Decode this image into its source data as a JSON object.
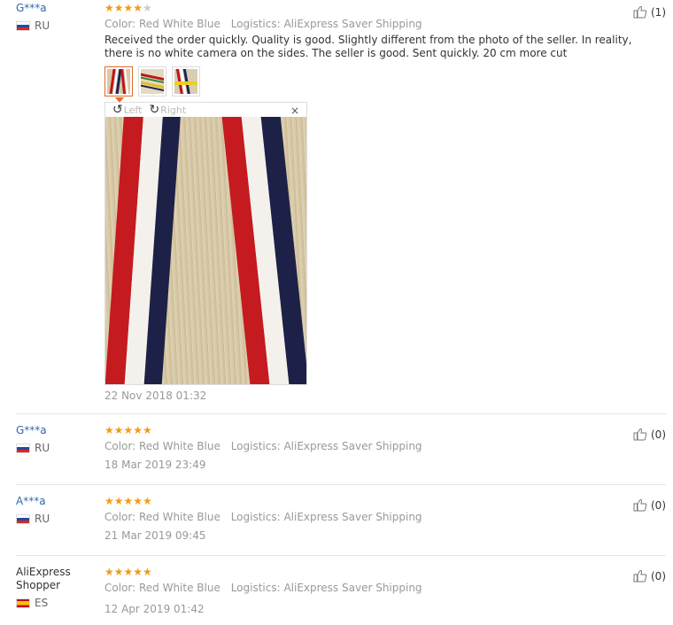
{
  "reviews": [
    {
      "user": "G***a",
      "country": "RU",
      "rating": 4,
      "color": "Color: Red White Blue",
      "logistics": "Logistics: AliExpress Saver Shipping",
      "text": "Received the order quickly. Quality is good. Slightly different from the photo of the seller. In reality, there is no white camera on the sides. The seller is good. Sent quickly. 20 cm more cut",
      "likes": "(1)",
      "date": "22 Nov 2018 01:32"
    },
    {
      "user": "G***a",
      "country": "RU",
      "rating": 5,
      "color": "Color: Red White Blue",
      "logistics": "Logistics: AliExpress Saver Shipping",
      "likes": "(0)",
      "date": "18 Mar 2019 23:49"
    },
    {
      "user": "A***a",
      "country": "RU",
      "rating": 5,
      "color": "Color: Red White Blue",
      "logistics": "Logistics: AliExpress Saver Shipping",
      "likes": "(0)",
      "date": "21 Mar 2019 09:45"
    },
    {
      "user": "AliExpress Shopper",
      "country": "ES",
      "rating": 5,
      "color": "Color: Red White Blue",
      "logistics": "Logistics: AliExpress Saver Shipping",
      "likes": "(0)",
      "date": "12 Apr 2019 01:42"
    }
  ],
  "viewer": {
    "rotate_left": "Left",
    "rotate_right": "Right",
    "close": "×"
  },
  "colors": {
    "star": "#f39c12",
    "link": "#3366aa",
    "active_border": "#e36b2b"
  }
}
